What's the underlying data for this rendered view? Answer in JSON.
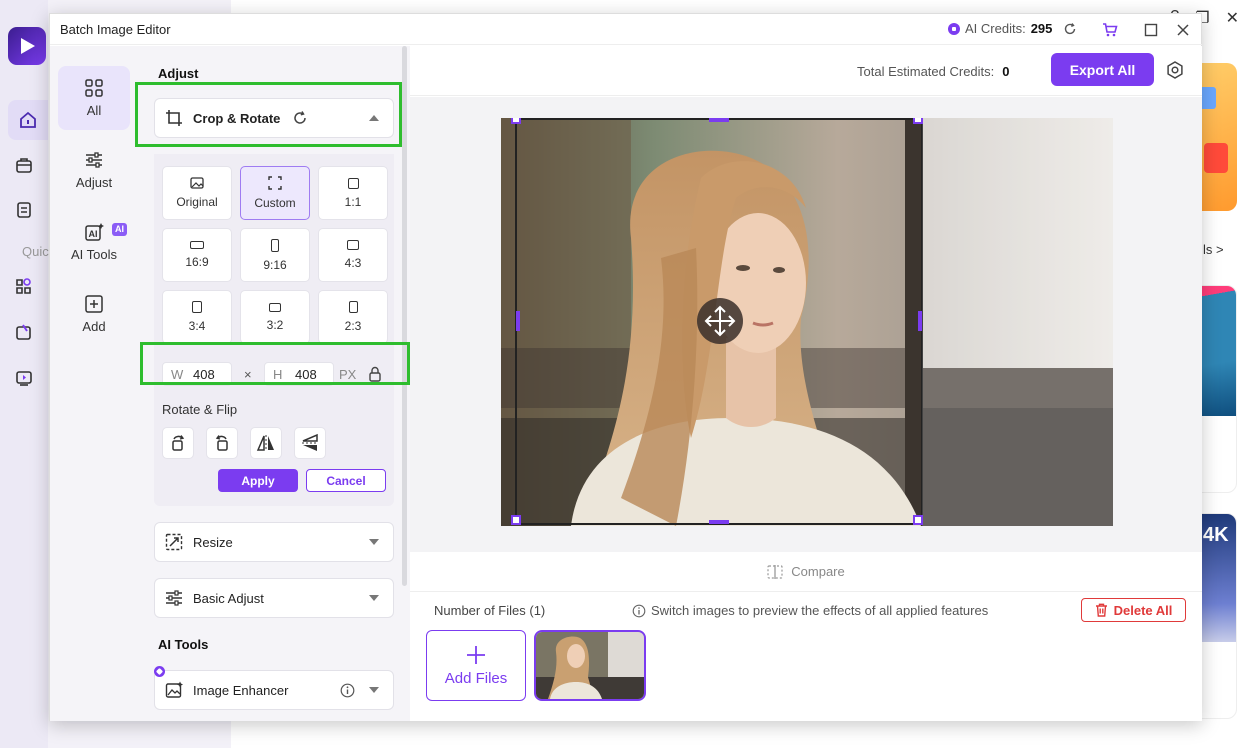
{
  "background": {
    "quick_label": "Quic",
    "link_label": "ls >",
    "badge_label": "w",
    "k4_label": "4K"
  },
  "dialog": {
    "title": "Batch Image Editor",
    "credits_label": "AI Credits:",
    "credits_value": "295"
  },
  "rail": {
    "items": [
      {
        "label": "All"
      },
      {
        "label": "Adjust"
      },
      {
        "label": "AI Tools"
      },
      {
        "label": "Add"
      }
    ],
    "ai_badge": "AI"
  },
  "panel": {
    "adjust_title": "Adjust",
    "crop_label": "Crop & Rotate",
    "ratios": [
      {
        "label": "Original"
      },
      {
        "label": "Custom"
      },
      {
        "label": "1:1"
      },
      {
        "label": "16:9"
      },
      {
        "label": "9:16"
      },
      {
        "label": "4:3"
      },
      {
        "label": "3:4"
      },
      {
        "label": "3:2"
      },
      {
        "label": "2:3"
      }
    ],
    "width_key": "W",
    "width_value": "408",
    "times": "×",
    "height_key": "H",
    "height_value": "408",
    "unit": "PX",
    "rotate_title": "Rotate & Flip",
    "apply_label": "Apply",
    "cancel_label": "Cancel",
    "resize_label": "Resize",
    "basic_adjust_label": "Basic Adjust",
    "ai_tools_title": "AI Tools",
    "enhancer_label": "Image Enhancer"
  },
  "main": {
    "est_label": "Total Estimated Credits:",
    "est_value": "0",
    "export_label": "Export All",
    "compare_label": "Compare",
    "files_label": "Number of Files (1)",
    "hint_label": "Switch images to preview the effects of all applied features",
    "delete_label": "Delete All",
    "add_files_label": "Add Files"
  },
  "colors": {
    "accent": "#7b3cf0",
    "highlight": "#2ebd2e",
    "danger": "#e03a3a"
  }
}
